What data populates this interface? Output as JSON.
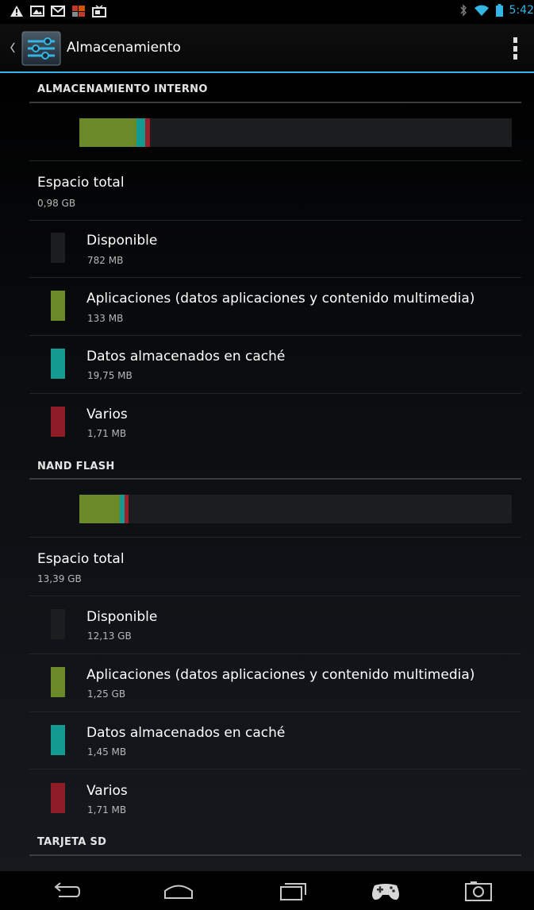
{
  "status_bar": {
    "time": "5:42",
    "left_icons": [
      "warning-icon",
      "image-icon",
      "gmail-icon",
      "photo-icon",
      "tv-icon"
    ],
    "right_icons": [
      "bluetooth-icon",
      "wifi-icon",
      "battery-icon"
    ]
  },
  "action_bar": {
    "title": "Almacenamiento",
    "app_icon": "settings-sliders-icon",
    "overflow_icon": "overflow-menu-icon"
  },
  "sections": [
    {
      "header": "ALMACENAMIENTO INTERNO",
      "usage_fractions": {
        "apps": 0.133,
        "cache": 0.02,
        "misc": 0.01
      },
      "total_label": "Espacio total",
      "total_value": "0,98 GB",
      "items": [
        {
          "title": "Disponible",
          "value": "782 MB",
          "color": "#1b1d1f"
        },
        {
          "title": "Aplicaciones (datos aplicaciones y contenido multimedia)",
          "value": "133 MB",
          "color": "#6a8a2a"
        },
        {
          "title": "Datos almacenados en caché",
          "value": "19,75 MB",
          "color": "#159a92"
        },
        {
          "title": "Varios",
          "value": "1,71 MB",
          "color": "#8f1d28"
        }
      ]
    },
    {
      "header": "NAND FLASH",
      "usage_fractions": {
        "apps": 0.093,
        "cache": 0.011,
        "misc": 0.01
      },
      "total_label": "Espacio total",
      "total_value": "13,39 GB",
      "items": [
        {
          "title": "Disponible",
          "value": "12,13 GB",
          "color": "#1b1d1f"
        },
        {
          "title": "Aplicaciones (datos aplicaciones y contenido multimedia)",
          "value": "1,25 GB",
          "color": "#6a8a2a"
        },
        {
          "title": "Datos almacenados en caché",
          "value": "1,45 MB",
          "color": "#159a92"
        },
        {
          "title": "Varios",
          "value": "1,71 MB",
          "color": "#8f1d28"
        }
      ]
    },
    {
      "header": "TARJETA SD"
    }
  ],
  "nav_bar": {
    "buttons": [
      "back-icon",
      "home-icon",
      "recent-apps-icon",
      "game-controller-icon",
      "screenshot-icon"
    ]
  },
  "colors": {
    "accent": "#33b5e5",
    "apps": "#6a8a2a",
    "cache": "#159a92",
    "misc": "#8f1d28",
    "free": "#1b1d1f"
  }
}
